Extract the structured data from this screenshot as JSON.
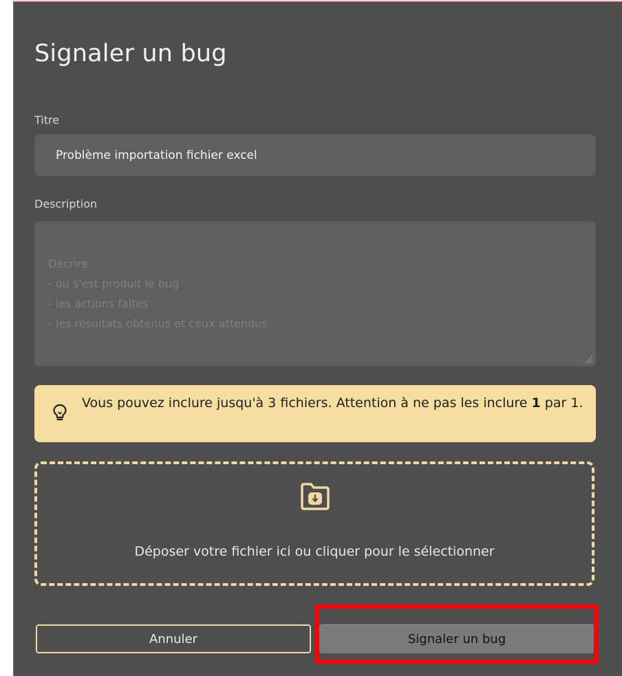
{
  "dialog": {
    "title": "Signaler un bug",
    "titre_label": "Titre",
    "titre_value": "Problème importation fichier excel",
    "description_label": "Description",
    "description_placeholder": "Décrire\n- où s'est produit le bug\n- les actions faites\n- les résultats obtenus et ceux attendus",
    "notice": {
      "text_part1": "Vous pouvez inclure jusqu'à 3 fichiers. Attention à ne pas les inclure ",
      "text_bold": "1",
      "text_part2": " par 1.",
      "icon": "lightbulb-icon",
      "background": "#f5dea0"
    },
    "dropzone": {
      "text": "Déposer votre fichier ici ou cliquer pour le sélectionner",
      "icon": "folder-download-icon"
    },
    "cancel_label": "Annuler",
    "submit_label": "Signaler un bug"
  },
  "colors": {
    "dialog_bg": "#4e4e4e",
    "field_bg": "#5f5f5f",
    "accent": "#f0d9a0",
    "highlight": "#ff0000"
  }
}
